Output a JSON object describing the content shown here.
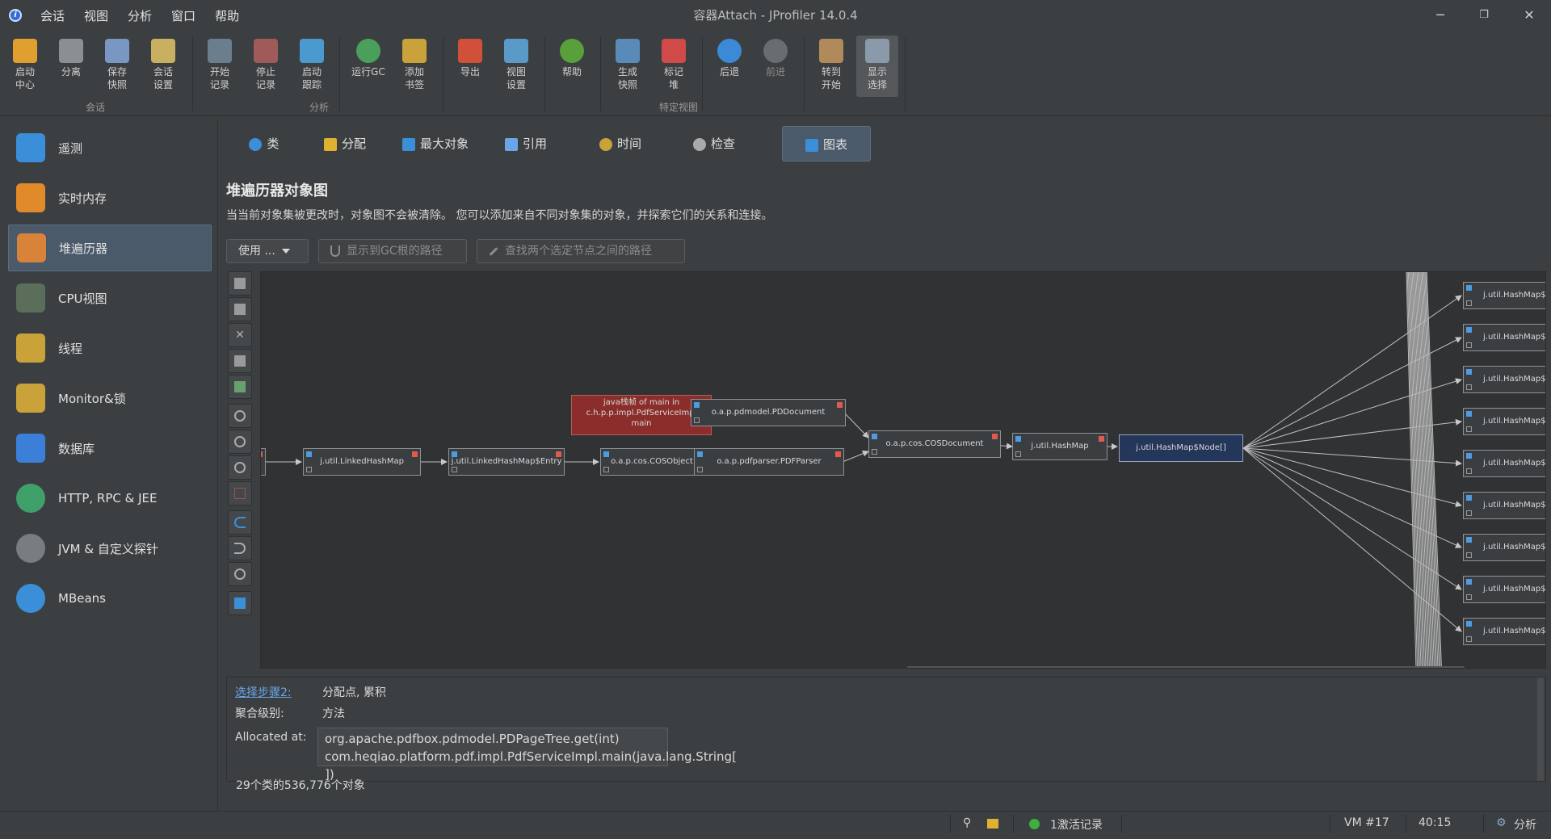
{
  "window": {
    "title": "容器Attach - JProfiler 14.0.4",
    "app_icon": "i",
    "minimize_icon": "─",
    "restore_icon": "❐",
    "close_icon": "✕"
  },
  "menu": [
    "会话",
    "视图",
    "分析",
    "窗口",
    "帮助"
  ],
  "toolbar": {
    "buttons": [
      {
        "label1": "启动",
        "label2": "中心",
        "icon": "start-center-icon"
      },
      {
        "label1": "分离",
        "label2": "",
        "icon": "detach-icon"
      },
      {
        "label1": "保存",
        "label2": "快照",
        "icon": "save-snapshot-icon"
      },
      {
        "label1": "会话",
        "label2": "设置",
        "icon": "session-settings-icon"
      },
      {
        "label1": "开始",
        "label2": "记录",
        "icon": "start-recording-icon"
      },
      {
        "label1": "停止",
        "label2": "记录",
        "icon": "stop-recording-icon"
      },
      {
        "label1": "启动",
        "label2": "跟踪",
        "icon": "start-tracking-icon"
      },
      {
        "label1": "运行GC",
        "label2": "",
        "icon": "run-gc-icon"
      },
      {
        "label1": "添加",
        "label2": "书签",
        "icon": "add-bookmark-icon"
      },
      {
        "label1": "导出",
        "label2": "",
        "icon": "export-icon"
      },
      {
        "label1": "视图",
        "label2": "设置",
        "icon": "view-settings-icon"
      },
      {
        "label1": "帮助",
        "label2": "",
        "icon": "help-icon"
      },
      {
        "label1": "生成",
        "label2": "快照",
        "icon": "take-snapshot-icon"
      },
      {
        "label1": "标记",
        "label2": "堆",
        "icon": "mark-heap-icon"
      },
      {
        "label1": "后退",
        "label2": "",
        "icon": "back-icon"
      },
      {
        "label1": "前进",
        "label2": "",
        "icon": "forward-icon"
      },
      {
        "label1": "转到",
        "label2": "开始",
        "icon": "go-to-start-icon"
      },
      {
        "label1": "显示",
        "label2": "选择",
        "icon": "show-selection-icon"
      }
    ],
    "groups": [
      "会话",
      "分析",
      "特定视图"
    ]
  },
  "sidebar": {
    "items": [
      {
        "label": "遥测",
        "icon": "telemetry-icon",
        "color": "#3b8fd8"
      },
      {
        "label": "实时内存",
        "icon": "live-memory-icon",
        "color": "#e08a2a"
      },
      {
        "label": "堆遍历器",
        "icon": "heap-walker-icon",
        "color": "#d9823a"
      },
      {
        "label": "CPU视图",
        "icon": "cpu-views-icon",
        "color": "#5a6e5a"
      },
      {
        "label": "线程",
        "icon": "threads-icon",
        "color": "#c9a23a"
      },
      {
        "label": "Monitor&锁",
        "icon": "lock-icon",
        "color": "#c9a23a"
      },
      {
        "label": "数据库",
        "icon": "database-icon",
        "color": "#3b7fd8"
      },
      {
        "label": "HTTP, RPC & JEE",
        "icon": "globe-icon",
        "color": "#3fa06a"
      },
      {
        "label": "JVM & 自定义探针",
        "icon": "probe-icon",
        "color": "#8a8a8a"
      },
      {
        "label": "MBeans",
        "icon": "mbeans-icon",
        "color": "#3b8fd8"
      }
    ]
  },
  "tabs": [
    {
      "label": "类",
      "icon": "classes-icon",
      "color": "#3b8fd8"
    },
    {
      "label": "分配",
      "icon": "allocations-icon",
      "color": "#e0b030"
    },
    {
      "label": "最大对象",
      "icon": "biggest-objects-icon",
      "color": "#3b8fd8"
    },
    {
      "label": "引用",
      "icon": "references-icon",
      "color": "#6aa5e8"
    },
    {
      "label": "时间",
      "icon": "time-icon",
      "color": "#c9a23a"
    },
    {
      "label": "检查",
      "icon": "inspections-icon",
      "color": "#aaaaaa"
    },
    {
      "label": "图表",
      "icon": "graph-icon",
      "color": "#3b8fd8"
    }
  ],
  "panel": {
    "title": "堆遍历器对象图",
    "description": "当当前对象集被更改时，对象图不会被清除。 您可以添加来自不同对象集的对象，并探索它们的关系和连接。",
    "use_button": "使用 ...",
    "gc_root_button": "显示到GC根的路径",
    "path_button": "查找两个选定节点之间的路径"
  },
  "graph": {
    "nodes": {
      "n1": "j.util.LinkedHashMap",
      "n2": "j.util.LinkedHashMap$Entry",
      "n3": "o.a.p.cos.COSObject",
      "n4_line1": "java栈帧 of main in",
      "n4_line2": "c.h.p.p.impl.PdfServiceImpl",
      "n4_line3": "main",
      "n5": "o.a.p.pdmodel.PDDocument",
      "n6": "o.a.p.pdfparser.PDFParser",
      "n7": "o.a.p.cos.COSDocument",
      "n8": "j.util.HashMap",
      "n9": "j.util.HashMap$Node[]"
    },
    "right_nodes": [
      "j.util.HashMap$Node",
      "j.util.HashMap$Node",
      "j.util.HashMap$Node",
      "j.util.HashMap$Node",
      "j.util.HashMap$Node",
      "j.util.HashMap$Node",
      "j.util.HashMap$Node",
      "j.util.HashMap$Node",
      "j.util.HashMap$Node"
    ]
  },
  "info": {
    "step_link": "选择步骤2:",
    "step_value": "分配点, 累积",
    "level_label": "聚合级别:",
    "level_value": "方法",
    "alloc_label": "Allocated at:",
    "alloc_line1": "org.apache.pdfbox.pdmodel.PDPageTree.get(int)",
    "alloc_line2": "com.heqiao.platform.pdf.impl.PdfServiceImpl.main(java.lang.String[ ])",
    "object_count": "29个类的536,776个对象"
  },
  "status": {
    "recording": "1激活记录",
    "vm": "VM #17",
    "time": "40:15",
    "analysis": "分析",
    "recording_color": "#3fae3f"
  }
}
